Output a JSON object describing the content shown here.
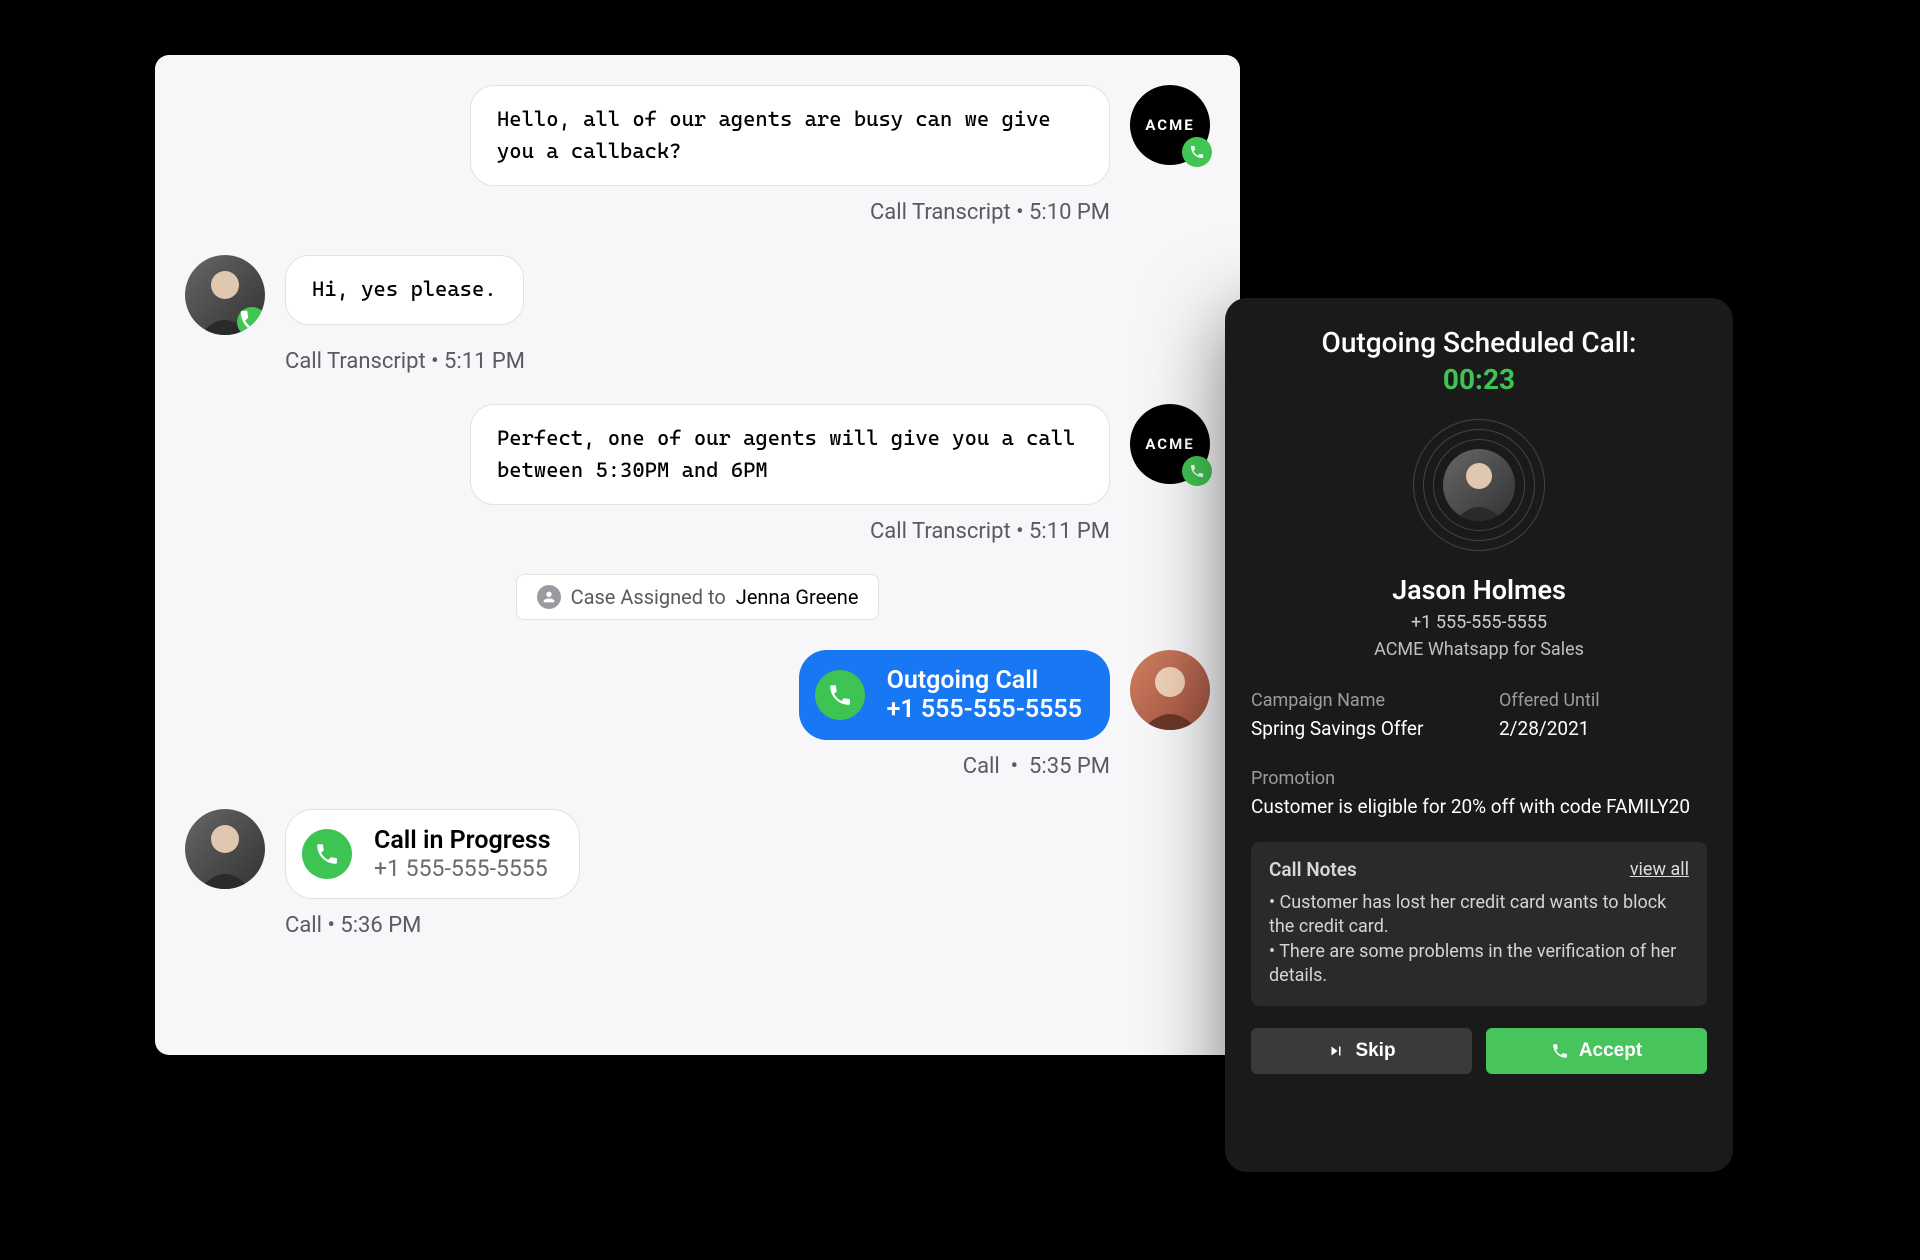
{
  "chat": {
    "messages": [
      {
        "side": "right",
        "senderType": "acme",
        "text": "Hello, all of our agents are busy can we give you a callback?",
        "metaLabel": "Call Transcript",
        "time": "5:10 PM"
      },
      {
        "side": "left",
        "senderType": "customer",
        "text": "Hi, yes please.",
        "metaLabel": "Call Transcript",
        "time": "5:11 PM"
      },
      {
        "side": "right",
        "senderType": "acme",
        "text": "Perfect, one of our agents will give you a call between 5:30PM and 6PM",
        "metaLabel": "Call Transcript",
        "time": "5:11 PM"
      }
    ],
    "assignment": {
      "prefix": "Case Assigned to ",
      "assignee": "Jenna Greene"
    },
    "outgoingCall": {
      "title": "Outgoing Call",
      "number": "+1 555-555-5555",
      "metaLabel": "Call",
      "time": "5:35 PM"
    },
    "inProgressCall": {
      "title": "Call in Progress",
      "number": "+1 555-555-5555",
      "metaLabel": "Call",
      "time": "5:36 PM"
    },
    "acmeLabel": "ACME"
  },
  "dial": {
    "title": "Outgoing Scheduled Call:",
    "timer": "00:23",
    "customerName": "Jason Holmes",
    "customerPhone": "+1 555-555-5555",
    "channel": "ACME Whatsapp for Sales",
    "campaign": {
      "label": "Campaign Name",
      "value": "Spring Savings Offer"
    },
    "offered": {
      "label": "Offered Until",
      "value": "2/28/2021"
    },
    "promotion": {
      "label": "Promotion",
      "value": "Customer is eligible for 20% off with code FAMILY20"
    },
    "notes": {
      "title": "Call Notes",
      "viewAll": "view all",
      "items": [
        "Customer has lost her credit card wants to block the credit card.",
        "There are some problems in the verification of her details."
      ]
    },
    "buttons": {
      "skip": "Skip",
      "accept": "Accept"
    }
  }
}
